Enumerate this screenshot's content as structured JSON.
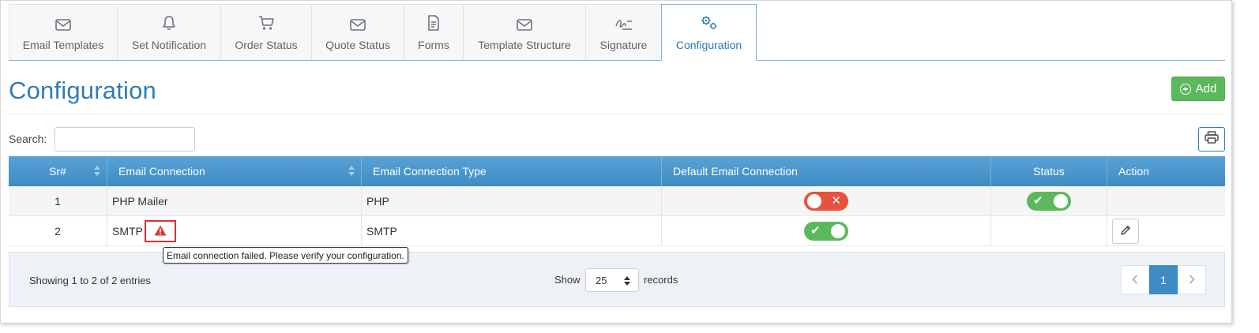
{
  "tabs": [
    {
      "label": "Email Templates",
      "icon": "envelope-icon"
    },
    {
      "label": "Set Notification",
      "icon": "bell-icon"
    },
    {
      "label": "Order Status",
      "icon": "cart-icon"
    },
    {
      "label": "Quote Status",
      "icon": "envelope-icon"
    },
    {
      "label": "Forms",
      "icon": "document-icon"
    },
    {
      "label": "Template Structure",
      "icon": "envelope-icon"
    },
    {
      "label": "Signature",
      "icon": "signature-icon"
    },
    {
      "label": "Configuration",
      "icon": "gears-icon",
      "active": true
    }
  ],
  "page": {
    "title": "Configuration",
    "add_label": "Add",
    "search_label": "Search:",
    "search_value": ""
  },
  "table": {
    "headers": [
      "Sr#",
      "Email Connection",
      "Email Connection Type",
      "Default Email Connection",
      "Status",
      "Action"
    ],
    "rows": [
      {
        "sr": "1",
        "connection": "PHP Mailer",
        "type": "PHP",
        "default_on": false,
        "status_on": true,
        "has_warning": false,
        "has_edit": false
      },
      {
        "sr": "2",
        "connection": "SMTP",
        "type": "SMTP",
        "default_on": true,
        "status_on": null,
        "has_warning": true,
        "has_edit": true
      }
    ]
  },
  "tooltip": "Email connection failed. Please verify your configuration.",
  "footer": {
    "info": "Showing 1 to 2 of 2 entries",
    "show_label": "Show",
    "page_size": "25",
    "records_label": "records",
    "current_page": "1"
  },
  "colors": {
    "accent": "#2f7db5",
    "header_bg": "#3f8bc6",
    "add_green": "#5cb85c",
    "toggle_off": "#e8513f",
    "toggle_on": "#5cb85c",
    "warning_red": "#d9363e"
  }
}
